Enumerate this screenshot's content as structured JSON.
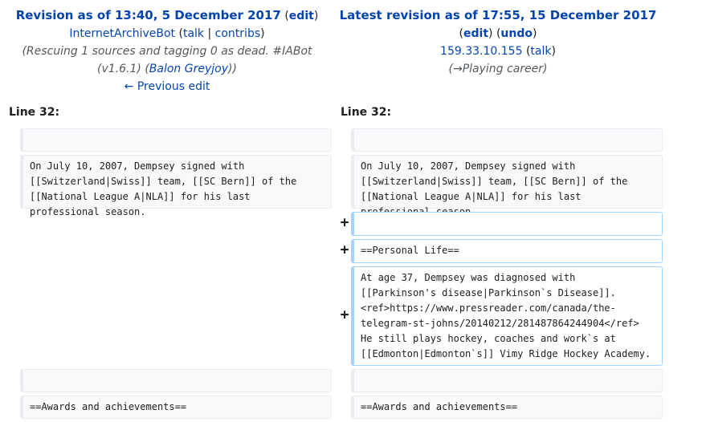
{
  "left": {
    "title": "Revision as of 13:40, 5 December 2017",
    "edit_label": "edit",
    "user": "InternetArchiveBot",
    "talk": "talk",
    "separator": "|",
    "contribs": "contribs",
    "summary_line1": "(Rescuing 1 sources and tagging 0 as dead. #IABot",
    "summary_version": "(v1.6.1) (",
    "summary_user": "Balon Greyjoy",
    "summary_close": "))",
    "prev_edit": "← Previous edit",
    "line_label": "Line 32:"
  },
  "right": {
    "title": "Latest revision as of 17:55, 15 December 2017",
    "edit_label": "edit",
    "undo_label": "undo",
    "user": "159.33.10.155",
    "talk": "talk",
    "summary_arrow": "→",
    "summary_section": "Playing career",
    "line_label": "Line 32:"
  },
  "diff": {
    "left_empty": "",
    "left_para": "On July 10, 2007, Dempsey signed with [[Switzerland|Swiss]] team, [[SC Bern]] of the [[National League A|NLA]] for his last professional season.",
    "left_empty2": "",
    "left_heading": "==Awards and achievements==",
    "right_empty": "",
    "right_para": "On July 10, 2007, Dempsey signed with [[Switzerland|Swiss]] team, [[SC Bern]] of the [[National League A|NLA]] for his last professional season.",
    "added_empty": "",
    "added_heading": "==Personal Life==",
    "added_para": "At age 37, Dempsey was diagnosed with [[Parkinson's disease|Parkinson`s Disease]]. <ref>https://www.pressreader.com/canada/the-telegram-st-johns/20140212/281487864244904</ref> He still plays hockey, coaches and work`s at [[Edmonton|Edmonton`s]] Vimy Ridge Hockey Academy.",
    "right_empty2": "",
    "right_heading": "==Awards and achievements==",
    "plus": "+"
  }
}
